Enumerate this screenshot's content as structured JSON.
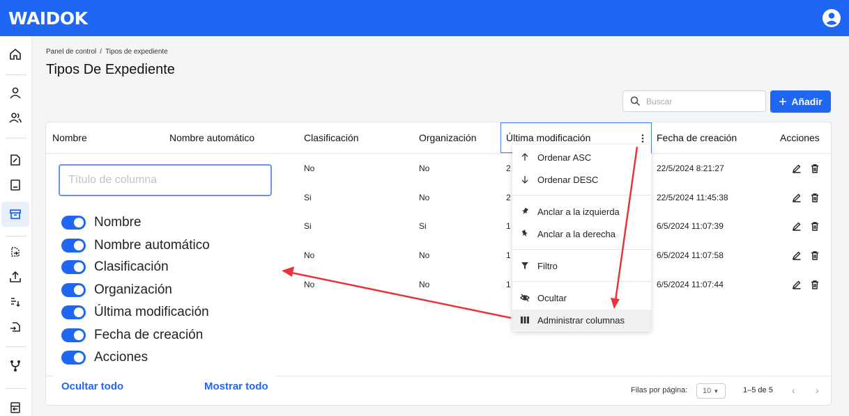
{
  "app": {
    "logo": "WAIDOK"
  },
  "breadcrumb": {
    "root": "Panel de control",
    "separator": "/",
    "current": "Tipos de expediente"
  },
  "page": {
    "title": "Tipos De Expediente"
  },
  "search": {
    "placeholder": "Buscar"
  },
  "toolbar": {
    "add_label": "Añadir"
  },
  "table": {
    "columns": [
      "Nombre",
      "Nombre automático",
      "Clasificación",
      "Organización",
      "Última modificación",
      "Fecha de creación",
      "Acciones"
    ],
    "rows": [
      {
        "clasificacion": "No",
        "organizacion": "No",
        "ultima_mod": "2",
        "fecha_creacion": "22/5/2024 8:21:27"
      },
      {
        "clasificacion": "Si",
        "organizacion": "No",
        "ultima_mod": "2",
        "fecha_creacion": "22/5/2024 11:45:38"
      },
      {
        "clasificacion": "Si",
        "organizacion": "Si",
        "ultima_mod": "1",
        "fecha_creacion": "6/5/2024 11:07:39"
      },
      {
        "clasificacion": "No",
        "organizacion": "No",
        "ultima_mod": "1",
        "fecha_creacion": "6/5/2024 11:07:58"
      },
      {
        "clasificacion": "No",
        "organizacion": "No",
        "ultima_mod": "1",
        "fecha_creacion": "6/5/2024 11:07:44"
      }
    ]
  },
  "column_panel": {
    "input_placeholder": "Título de columna",
    "items": [
      "Nombre",
      "Nombre automático",
      "Clasificación",
      "Organización",
      "Última modificación",
      "Fecha de creación",
      "Acciones"
    ],
    "hide_all": "Ocultar todo",
    "show_all": "Mostrar todo"
  },
  "column_menu": {
    "items": [
      "Ordenar ASC",
      "Ordenar DESC",
      "Anclar a la izquierda",
      "Anclar a la derecha",
      "Filtro",
      "Ocultar",
      "Administrar columnas"
    ]
  },
  "pagination": {
    "rows_per_page_label": "Filas por página:",
    "rows_per_page": "10",
    "range": "1–5 de 5"
  },
  "colors": {
    "primary": "#1f67f2",
    "annotation_arrow": "#e8323c"
  }
}
